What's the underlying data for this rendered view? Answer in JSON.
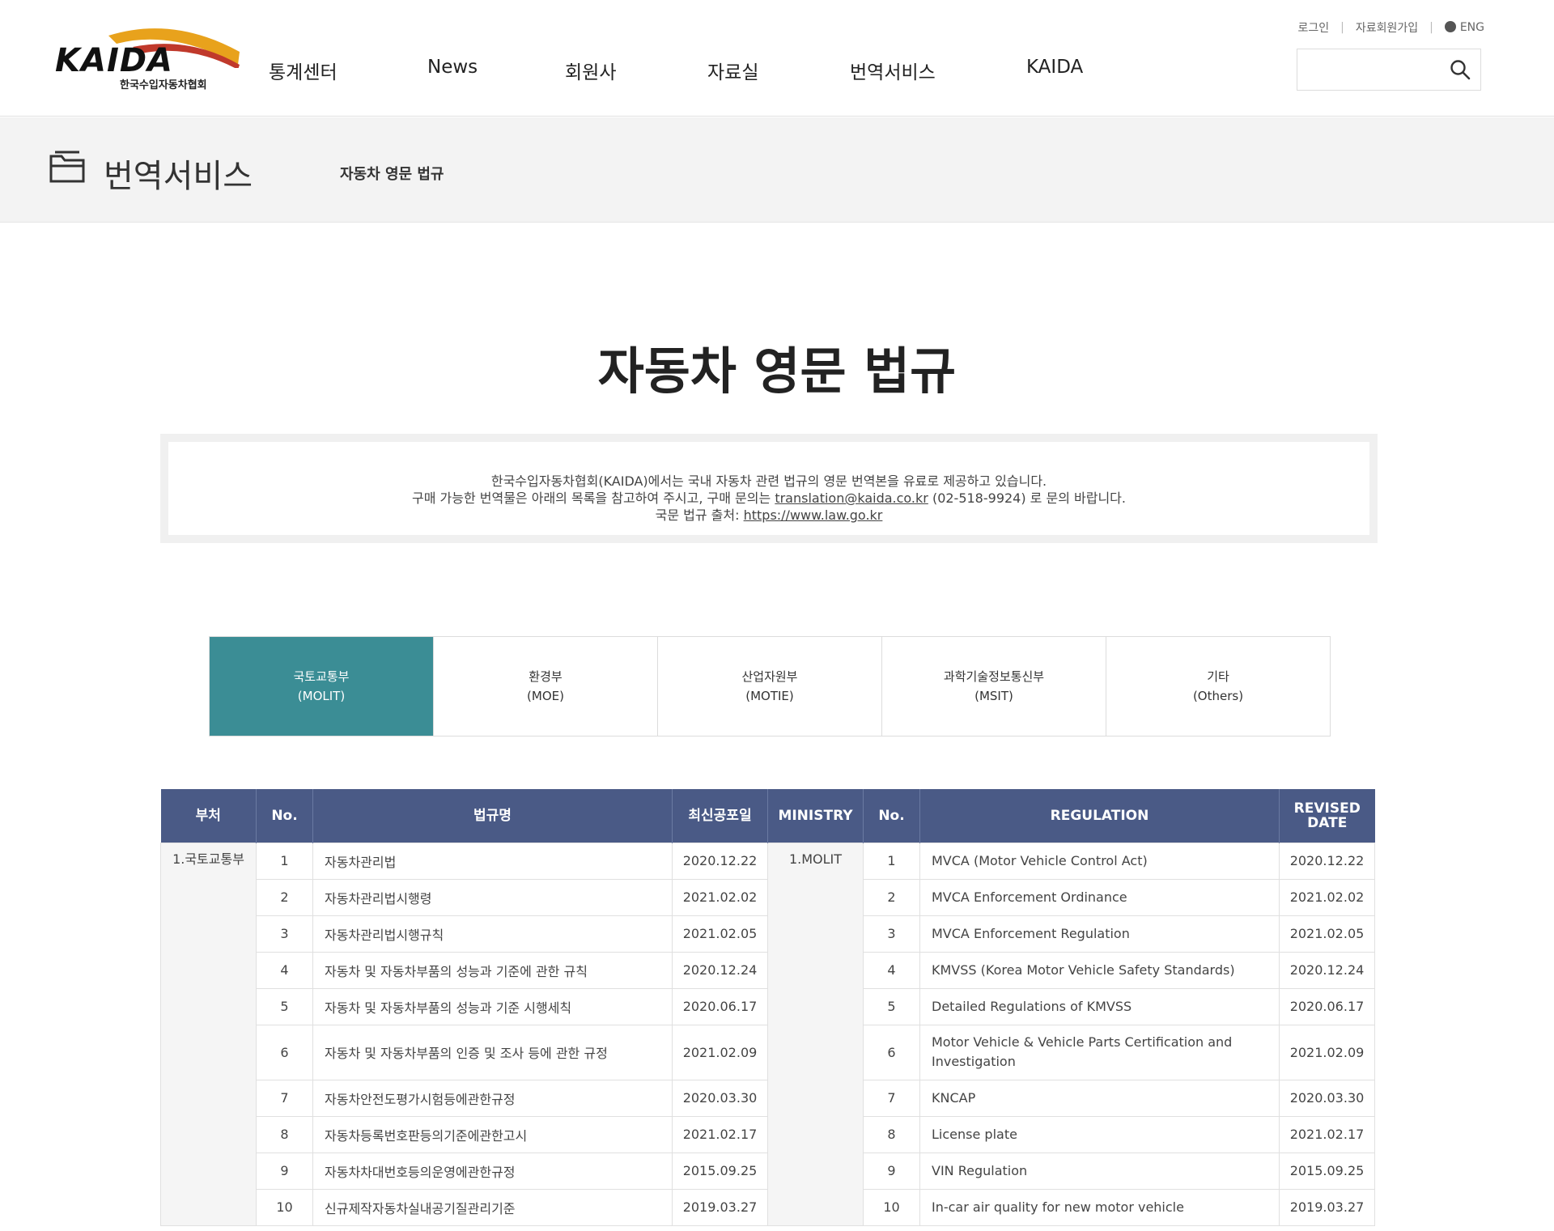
{
  "header": {
    "logo_text": "KAIDA",
    "logo_sub": "한국수입자동차협회",
    "nav": [
      "통계센터",
      "News",
      "회원사",
      "자료실",
      "번역서비스",
      "KAIDA"
    ],
    "util": {
      "login": "로그인",
      "signup": "자료회원가입",
      "lang": "ENG"
    },
    "search_placeholder": ""
  },
  "subbar": {
    "title": "번역서비스",
    "crumb": "자동차 영문 법규"
  },
  "page_title": "자동차 영문 법규",
  "notice": {
    "line1": "한국수입자동차협회(KAIDA)에서는 국내 자동차 관련 법규의 영문 번역본을 유료로 제공하고 있습니다.",
    "line2_pre": "구매 가능한 번역물은 아래의 목록을 참고하여 주시고, 구매 문의는 ",
    "email": "translation@kaida.co.kr",
    "line2_post": " (02-518-9924) 로 문의 바랍니다.",
    "line3_pre": "국문 법규 출처: ",
    "law_url": "https://www.law.go.kr"
  },
  "tabs": [
    {
      "ko": "국토교통부",
      "en": "(MOLIT)"
    },
    {
      "ko": "환경부",
      "en": "(MOE)"
    },
    {
      "ko": "산업자원부",
      "en": "(MOTIE)"
    },
    {
      "ko": "과학기술정보통신부",
      "en": "(MSIT)"
    },
    {
      "ko": "기타",
      "en": "(Others)"
    }
  ],
  "table": {
    "headers": {
      "dept": "부처",
      "no": "No.",
      "name": "법규명",
      "latest": "최신공포일",
      "ministry": "MINISTRY",
      "no_en": "No.",
      "regulation": "REGULATION",
      "revised_1": "REVISED",
      "revised_2": "DATE"
    },
    "dept_cell": "1.국토교통부",
    "ministry_cell": "1.MOLIT",
    "rows": [
      {
        "no": "1",
        "name": "자동차관리법",
        "date": "2020.12.22",
        "reg": "MVCA (Motor Vehicle Control Act)",
        "rdate": "2020.12.22"
      },
      {
        "no": "2",
        "name": "자동차관리법시행령",
        "date": "2021.02.02",
        "reg": "MVCA Enforcement Ordinance",
        "rdate": "2021.02.02"
      },
      {
        "no": "3",
        "name": "자동차관리법시행규칙",
        "date": "2021.02.05",
        "reg": "MVCA Enforcement Regulation",
        "rdate": "2021.02.05"
      },
      {
        "no": "4",
        "name": "자동차 및 자동차부품의 성능과 기준에 관한 규칙",
        "date": "2020.12.24",
        "reg": "KMVSS (Korea Motor Vehicle Safety Standards)",
        "rdate": "2020.12.24"
      },
      {
        "no": "5",
        "name": "자동차 및 자동차부품의 성능과 기준 시행세칙",
        "date": "2020.06.17",
        "reg": "Detailed Regulations of KMVSS",
        "rdate": "2020.06.17"
      },
      {
        "no": "6",
        "name": "자동차 및 자동차부품의 인증 및 조사 등에 관한 규정",
        "date": "2021.02.09",
        "reg": "Motor Vehicle & Vehicle Parts Certification and Investigation",
        "rdate": "2021.02.09"
      },
      {
        "no": "7",
        "name": "자동차안전도평가시험등에관한규정",
        "date": "2020.03.30",
        "reg": "KNCAP",
        "rdate": "2020.03.30"
      },
      {
        "no": "8",
        "name": "자동차등록번호판등의기준에관한고시",
        "date": "2021.02.17",
        "reg": "License plate",
        "rdate": "2021.02.17"
      },
      {
        "no": "9",
        "name": "자동차차대번호등의운영에관한규정",
        "date": "2015.09.25",
        "reg": "VIN Regulation",
        "rdate": "2015.09.25"
      },
      {
        "no": "10",
        "name": "신규제작자동차실내공기질관리기준",
        "date": "2019.03.27",
        "reg": "In-car air quality for new motor vehicle",
        "rdate": "2019.03.27"
      }
    ]
  },
  "colors": {
    "tab_active": "#3b8d95",
    "table_header": "#4a5a86"
  }
}
